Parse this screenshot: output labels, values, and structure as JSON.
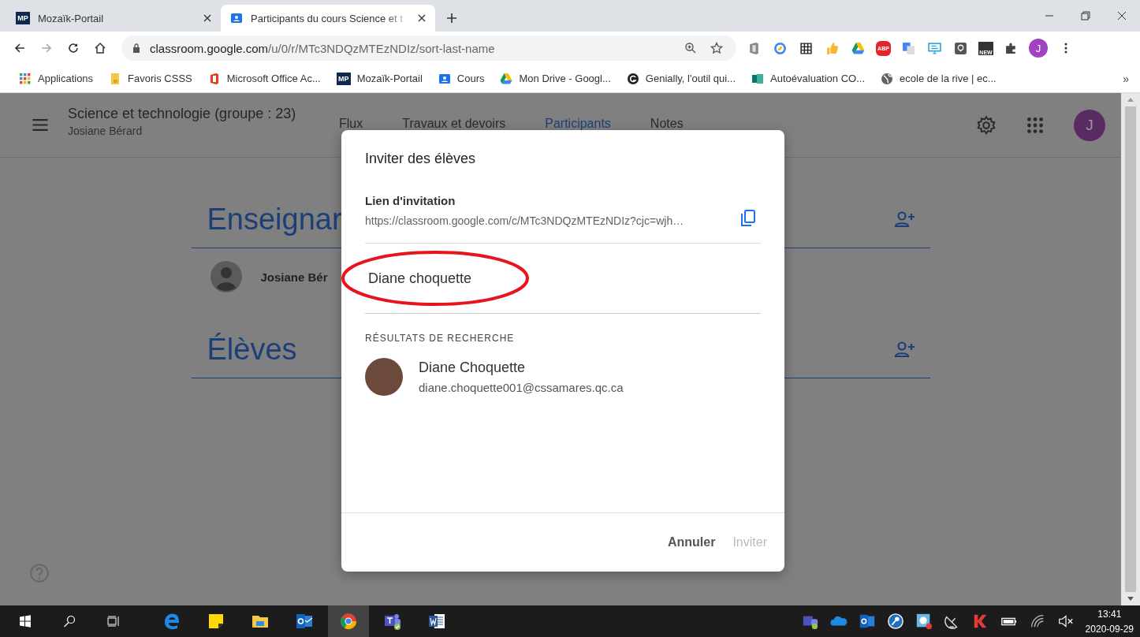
{
  "browser": {
    "tabs": [
      {
        "title": "Mozaïk-Portail",
        "kind": "mp",
        "selected": false
      },
      {
        "title": "Participants du cours Science et t",
        "kind": "classroom",
        "selected": true
      }
    ],
    "favicon_label": "MP",
    "url": {
      "domain": "classroom.google.com",
      "path": "/u/0/r/MTc3NDQzMTEzNDIz/sort-last-name"
    },
    "extensions": [
      {
        "kind": "office"
      },
      {
        "kind": "pencil"
      },
      {
        "kind": "grid"
      },
      {
        "kind": "thumb"
      },
      {
        "kind": "drive"
      },
      {
        "kind": "abp",
        "label": "ABP"
      },
      {
        "kind": "translate"
      },
      {
        "kind": "monitor"
      },
      {
        "kind": "bulb"
      },
      {
        "kind": "new",
        "label": "NEW"
      },
      {
        "kind": "puzzle"
      }
    ],
    "profile_initial": "J",
    "bookmarks": [
      {
        "title": "Applications",
        "kind": "apps"
      },
      {
        "title": "Favoris CSSS",
        "kind": "folder"
      },
      {
        "title": "Microsoft Office Ac...",
        "kind": "office"
      },
      {
        "title": "Mozaïk-Portail",
        "kind": "mp",
        "label": "MP"
      },
      {
        "title": "Cours",
        "kind": "classroom"
      },
      {
        "title": "Mon Drive - Googl...",
        "kind": "drive"
      },
      {
        "title": "Genially, l'outil qui...",
        "kind": "genially"
      },
      {
        "title": "Autoévaluation CO...",
        "kind": "forms"
      },
      {
        "title": "ecole de la rive | ec...",
        "kind": "globe"
      }
    ],
    "bookmarks_more": "»"
  },
  "classroom": {
    "course_title": "Science et technologie (groupe : 23)",
    "teacher": "Josiane Bérard",
    "nav": [
      {
        "label": "Flux",
        "selected": false
      },
      {
        "label": "Travaux et devoirs",
        "selected": false
      },
      {
        "label": "Participants",
        "selected": true
      },
      {
        "label": "Notes",
        "selected": false
      }
    ],
    "profile_initial": "J",
    "sections": [
      {
        "title": "Enseignar",
        "people": [
          {
            "name": "Josiane Bér"
          }
        ]
      },
      {
        "title": "Élèves"
      }
    ]
  },
  "dialog": {
    "title": "Inviter des élèves",
    "link_label": "Lien d'invitation",
    "link_url": "https://classroom.google.com/c/MTc3NDQzMTEzNDIz?cjc=wjh…",
    "search_value": "Diane choquette",
    "results_heading": "RÉSULTATS DE RECHERCHE",
    "results": [
      {
        "name": "Diane Choquette",
        "email": "diane.choquette001@cssamares.qc.ca"
      }
    ],
    "buttons": [
      {
        "label": "Annuler",
        "disabled": false
      },
      {
        "label": "Inviter",
        "disabled": true
      }
    ]
  },
  "taskbar": {
    "apps": [
      {
        "kind": "edge",
        "selected": false
      },
      {
        "kind": "sticky",
        "selected": false
      },
      {
        "kind": "explorer",
        "selected": false
      },
      {
        "kind": "outlook",
        "selected": false
      },
      {
        "kind": "chrome",
        "selected": true
      },
      {
        "kind": "teams",
        "selected": false
      },
      {
        "kind": "word",
        "selected": false
      }
    ],
    "tray": [
      {
        "kind": "teams"
      },
      {
        "kind": "onedrive"
      },
      {
        "kind": "outlook"
      },
      {
        "kind": "key"
      },
      {
        "kind": "disc"
      },
      {
        "kind": "satellite"
      },
      {
        "kind": "kaspersky"
      },
      {
        "kind": "battery"
      },
      {
        "kind": "wifi"
      },
      {
        "kind": "volume"
      }
    ],
    "time": "13:41",
    "date": "2020-09-29"
  }
}
